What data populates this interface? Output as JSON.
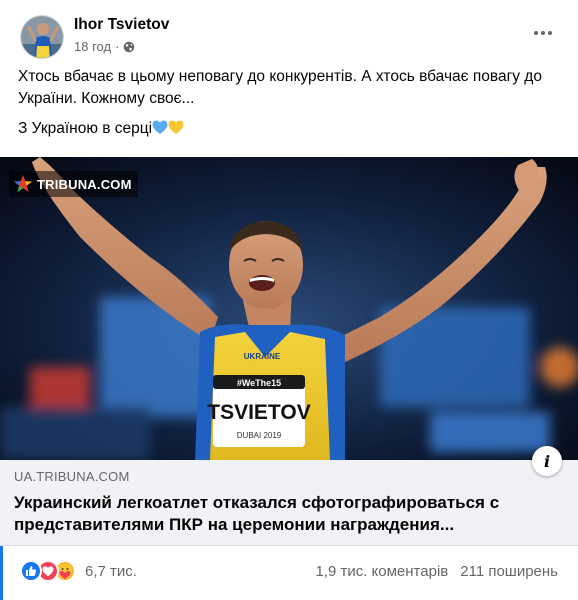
{
  "post": {
    "author": "Ihor Tsvietov",
    "time": "18 год",
    "separator": "·",
    "privacy_icon": "globe-icon",
    "more_icon": "more-dots-icon",
    "text_line_1": "Хтось вбачає в цьому неповагу до конкурентів. А хтось вбачає повагу до України. Кожному своє...",
    "text_line_2": "З Україною в серці"
  },
  "image": {
    "watermark": "TRIBUNA.COM",
    "bib_brand": "#WeThe15",
    "bib_name": "TSVIETOV",
    "bib_small": "DUBAI 2019",
    "jersey_text": "UKRAINE"
  },
  "link_preview": {
    "domain": "UA.TRIBUNA.COM",
    "headline": "Украинский легкоатлет отказался сфотографироваться с представителями ПКР на церемонии награждения...",
    "info_label": "i"
  },
  "footer": {
    "reaction_count": "6,7 тис.",
    "comments": "1,9 тис. коментарів",
    "shares": "211 поширень"
  },
  "colors": {
    "accent": "#1877f2",
    "heart_blue": "#5aaaf0",
    "heart_yellow": "#f7c531"
  }
}
